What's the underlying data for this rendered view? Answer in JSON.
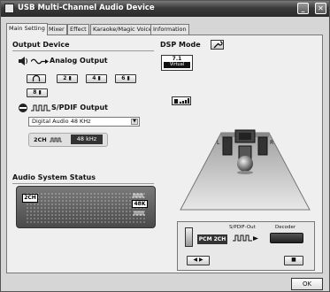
{
  "window": {
    "title": "USB Multi-Channel Audio Device"
  },
  "tabs": [
    {
      "label": "Main Setting"
    },
    {
      "label": "Mixer"
    },
    {
      "label": "Effect"
    },
    {
      "label": "Karaoke/Magic Voice"
    },
    {
      "label": "Information"
    }
  ],
  "output_device": {
    "title": "Output Device",
    "analog_label": "Analog Output",
    "channel_buttons": [
      "2",
      "4",
      "6",
      "8"
    ],
    "spdif_label": "S/PDIF Output",
    "spdif_select": "Digital Audio 48 KHz",
    "spdif_channel": "2CH",
    "spdif_rate": "48 kHz"
  },
  "audio_status": {
    "title": "Audio System Status",
    "channels": "2CH",
    "rate": "48K"
  },
  "dsp": {
    "title": "DSP Mode",
    "mode_badge_top": "7.1",
    "mode_badge_bottom": "Virtual",
    "pcm_label": "PCM 2CH",
    "spdif_out_label": "S/PDIF-Out",
    "decoder_label": "Decoder"
  },
  "footer": {
    "ok_label": "OK"
  }
}
